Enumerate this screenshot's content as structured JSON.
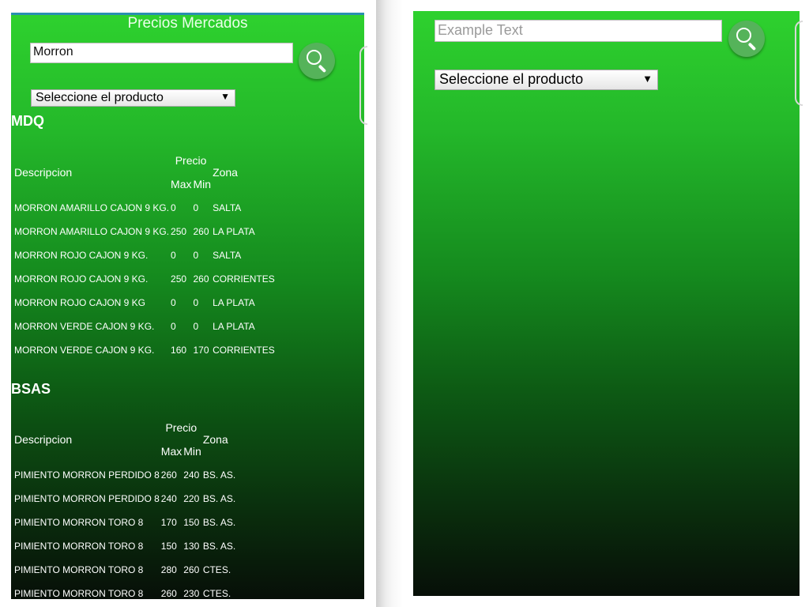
{
  "left_screen": {
    "title": "Precios Mercados",
    "search": {
      "value": "Morron",
      "button_icon": "search-icon"
    },
    "product_select": {
      "selected": "Seleccione el producto",
      "arrow": "▼"
    },
    "markets": [
      {
        "name": "MDQ",
        "headers": {
          "descripcion": "Descripcion",
          "precio": "Precio",
          "max": "Max",
          "min": "Min",
          "zona": "Zona"
        },
        "rows": [
          {
            "descripcion": "MORRON AMARILLO CAJON 9 KG.",
            "max": "0",
            "min": "0",
            "zona": "SALTA"
          },
          {
            "descripcion": "MORRON AMARILLO CAJON 9 KG.",
            "max": "250",
            "min": "260",
            "zona": "LA PLATA"
          },
          {
            "descripcion": "MORRON ROJO CAJON 9 KG.",
            "max": "0",
            "min": "0",
            "zona": "SALTA"
          },
          {
            "descripcion": "MORRON ROJO CAJON 9 KG.",
            "max": "250",
            "min": "260",
            "zona": "CORRIENTES"
          },
          {
            "descripcion": "MORRON ROJO CAJON 9 KG",
            "max": "0",
            "min": "0",
            "zona": "LA PLATA"
          },
          {
            "descripcion": "MORRON VERDE CAJON 9 KG.",
            "max": "0",
            "min": "0",
            "zona": "LA PLATA"
          },
          {
            "descripcion": "MORRON VERDE CAJON 9 KG.",
            "max": "160",
            "min": "170",
            "zona": "CORRIENTES"
          }
        ]
      },
      {
        "name": "BSAS",
        "headers": {
          "descripcion": "Descripcion",
          "precio": "Precio",
          "max": "Max",
          "min": "Min",
          "zona": "Zona"
        },
        "rows": [
          {
            "descripcion": "PIMIENTO MORRON PERDIDO 8",
            "max": "260",
            "min": "240",
            "zona": "BS. AS."
          },
          {
            "descripcion": "PIMIENTO MORRON PERDIDO 8",
            "max": "240",
            "min": "220",
            "zona": "BS. AS."
          },
          {
            "descripcion": "PIMIENTO MORRON TORO 8",
            "max": "170",
            "min": "150",
            "zona": "BS. AS."
          },
          {
            "descripcion": "PIMIENTO MORRON TORO 8",
            "max": "150",
            "min": "130",
            "zona": "BS. AS."
          },
          {
            "descripcion": "PIMIENTO MORRON TORO 8",
            "max": "280",
            "min": "260",
            "zona": "CTES."
          },
          {
            "descripcion": "PIMIENTO MORRON TORO 8",
            "max": "260",
            "min": "230",
            "zona": "CTES."
          }
        ]
      }
    ]
  },
  "right_screen": {
    "search": {
      "placeholder": "Example Text",
      "button_icon": "search-icon"
    },
    "product_select": {
      "selected": "Seleccione el producto",
      "arrow": "▼"
    }
  },
  "colors": {
    "gradient_top": "#2ed12e",
    "gradient_bottom": "#070f08",
    "search_button": "#55b35a",
    "title_bar_accent": "#2a8fb0"
  }
}
